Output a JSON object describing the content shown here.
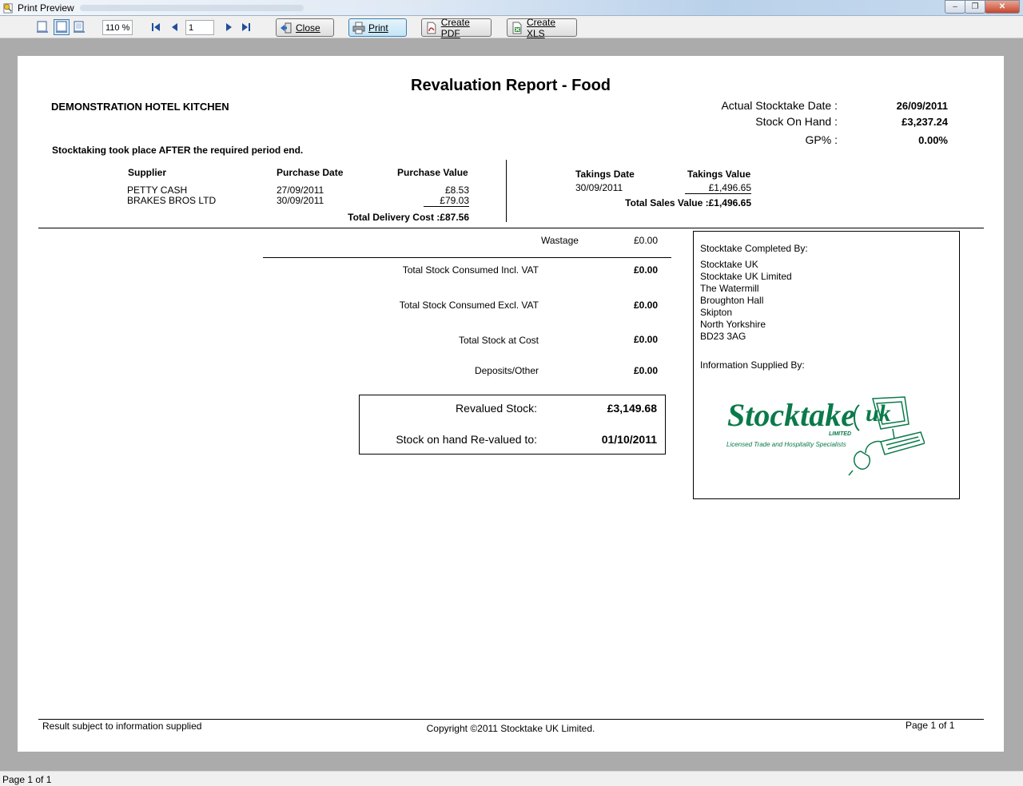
{
  "window": {
    "title": "Print Preview",
    "min_glyph": "–",
    "max_glyph": "❐",
    "close_glyph": "✕"
  },
  "toolbar": {
    "zoom": "110 %",
    "page_number": "1",
    "close_label": "Close",
    "print_label": "Print",
    "pdf_label": "Create PDF",
    "xls_label": "Create XLS"
  },
  "report": {
    "title": "Revaluation Report - Food",
    "hotel": "DEMONSTRATION HOTEL KITCHEN",
    "header": {
      "stocktake_date_label": "Actual Stocktake Date :",
      "stocktake_date": "26/09/2011",
      "stock_on_hand_label": "Stock On Hand :",
      "stock_on_hand": "£3,237.24",
      "gp_label": "GP% :",
      "gp": "0.00%"
    },
    "note": "Stocktaking took place AFTER the required period end.",
    "purchases": {
      "headers": [
        "Supplier",
        "Purchase Date",
        "Purchase Value"
      ],
      "rows": [
        {
          "supplier": "PETTY CASH",
          "date": "27/09/2011",
          "value": "£8.53"
        },
        {
          "supplier": "BRAKES BROS LTD",
          "date": "30/09/2011",
          "value": "£79.03"
        }
      ],
      "total_label": "Total Delivery Cost :",
      "total": "£87.56"
    },
    "takings": {
      "headers": [
        "Takings Date",
        "Takings Value"
      ],
      "rows": [
        {
          "date": "30/09/2011",
          "value": "£1,496.65"
        }
      ],
      "total_label": "Total Sales Value :",
      "total": "£1,496.65"
    },
    "lines": {
      "wastage_label": "Wastage",
      "wastage": "£0.00",
      "consumed_incl_label": "Total Stock Consumed Incl. VAT",
      "consumed_incl": "£0.00",
      "consumed_excl_label": "Total Stock Consumed Excl. VAT",
      "consumed_excl": "£0.00",
      "stock_cost_label": "Total Stock at Cost",
      "stock_cost": "£0.00",
      "deposits_label": "Deposits/Other",
      "deposits": "£0.00"
    },
    "summary": {
      "revalued_label": "Revalued Stock:",
      "revalued": "£3,149.68",
      "revalued_to_label": "Stock on hand Re-valued to:",
      "revalued_to": "01/10/2011"
    },
    "completed_by": {
      "heading": "Stocktake Completed By:",
      "address": [
        "Stocktake UK",
        "Stocktake UK Limited",
        "The Watermill",
        "Broughton Hall",
        "Skipton",
        "North Yorkshire",
        "BD23 3AG"
      ],
      "info_heading": "Information Supplied By:"
    },
    "logo": {
      "name": "Stocktake",
      "uk": "uk",
      "limited": "LIMITED",
      "tagline": "Licensed Trade and Hospitality Specialists",
      "color": "#0a7a4a"
    },
    "footer": {
      "left": "Result subject to information supplied",
      "center": "Copyright ©2011 Stocktake UK Limited.",
      "right": "Page 1 of 1"
    }
  },
  "statusbar": {
    "text": "Page 1 of 1"
  }
}
